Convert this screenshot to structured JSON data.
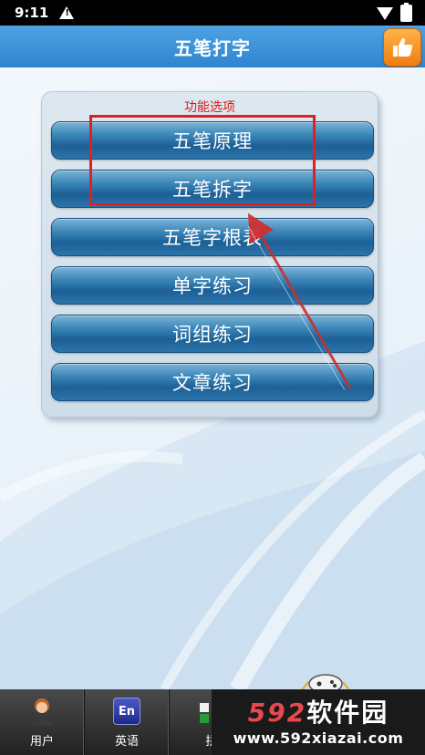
{
  "status_bar": {
    "time": "9:11"
  },
  "header": {
    "title": "五笔打字"
  },
  "options_panel": {
    "title": "功能选项",
    "items": [
      {
        "label": "五笔原理"
      },
      {
        "label": "五笔拆字"
      },
      {
        "label": "五笔字根表"
      },
      {
        "label": "单字练习"
      },
      {
        "label": "词组练习"
      },
      {
        "label": "文章练习"
      }
    ]
  },
  "bottom_nav": {
    "items": [
      {
        "label": "用户",
        "icon": "user-avatar-icon"
      },
      {
        "label": "英语",
        "icon": "en-icon",
        "icon_text": "En"
      },
      {
        "label": "拼",
        "icon": "pinyin-icon"
      }
    ]
  },
  "watermark": {
    "number": "592",
    "text": "软件园",
    "url": "www.592xiazai.com"
  },
  "colors": {
    "header_blue": "#3a8fd8",
    "button_blue": "#1c5f95",
    "highlight_red": "#e02020",
    "panel_title_red": "#e01818"
  }
}
